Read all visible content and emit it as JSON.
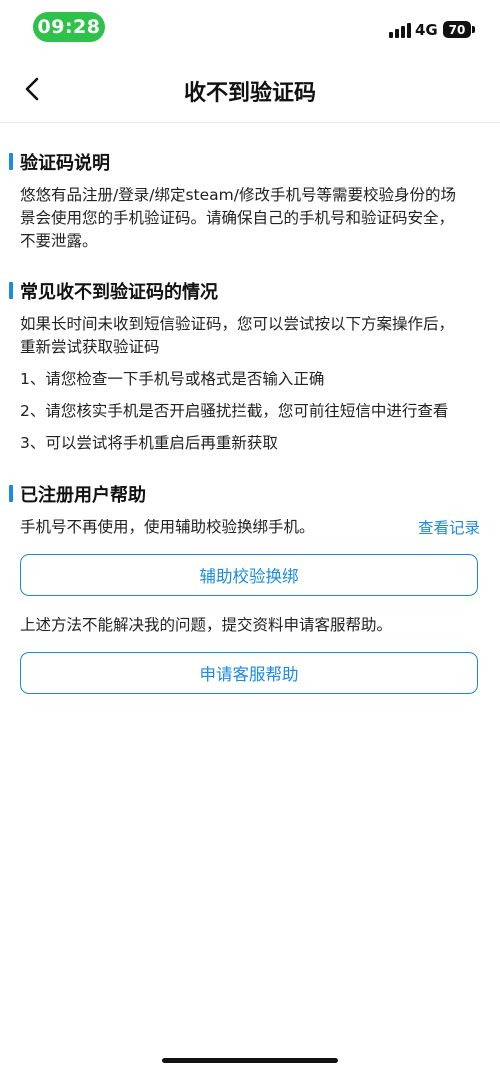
{
  "status_bar": {
    "time": "09:28",
    "network": "4G",
    "battery": "70"
  },
  "nav": {
    "title": "收不到验证码"
  },
  "sections": {
    "explain": {
      "heading": "验证码说明",
      "line1": "悠悠有品注册/登录/绑定steam/修改手机号等需要校验身份的场",
      "line2": "景会使用您的手机验证码。请确保自己的手机号和验证码安全，",
      "line3": "不要泄露。"
    },
    "common": {
      "heading": "常见收不到验证码的情况",
      "intro1": "如果长时间未收到短信验证码，您可以尝试按以下方案操作后，",
      "intro2": "重新尝试获取验证码",
      "step1": "1、请您检查一下手机号或格式是否输入正确",
      "step2": "2、请您核实手机是否开启骚扰拦截，您可前往短信中进行查看",
      "step3": "3、可以尝试将手机重启后再重新获取"
    },
    "registered": {
      "heading": "已注册用户帮助",
      "desc": "手机号不再使用，使用辅助校验换绑手机。",
      "view_records": "查看记录",
      "assist_button": "辅助校验换绑",
      "fallback_text": "上述方法不能解决我的问题，提交资料申请客服帮助。",
      "support_button": "申请客服帮助"
    }
  },
  "colors": {
    "accent": "#1a8be0",
    "time_pill": "#2fc24b"
  },
  "icons": {
    "back": "chevron-left-icon",
    "signal": "signal-bars-icon",
    "battery": "battery-icon"
  }
}
